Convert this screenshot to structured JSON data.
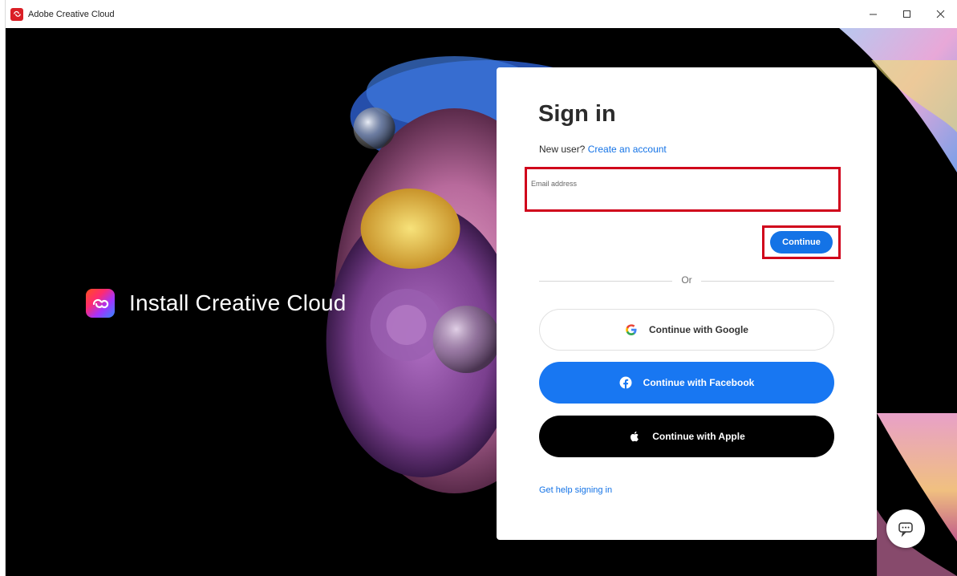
{
  "window": {
    "title": "Adobe Creative Cloud",
    "controls": [
      "minimize",
      "maximize",
      "close"
    ]
  },
  "hero": {
    "text": "Install Creative Cloud",
    "logo_icon": "creative-cloud-logo-icon"
  },
  "signin": {
    "title": "Sign in",
    "new_user_prefix": "New user?",
    "create_account_link": "Create an account",
    "email_placeholder": "Email address",
    "email_value": "",
    "continue_label": "Continue",
    "or_label": "Or",
    "google_label": "Continue with Google",
    "facebook_label": "Continue with Facebook",
    "apple_label": "Continue with Apple",
    "help_link": "Get help signing in"
  },
  "colors": {
    "accent_blue": "#1473e6",
    "facebook_blue": "#1877f2",
    "highlight_red": "#d0021b",
    "background": "#000000"
  },
  "icons": [
    "adobe-cc-app-icon",
    "minimize-icon",
    "maximize-icon",
    "close-icon",
    "google-icon",
    "facebook-icon",
    "apple-icon",
    "chat-icon"
  ]
}
